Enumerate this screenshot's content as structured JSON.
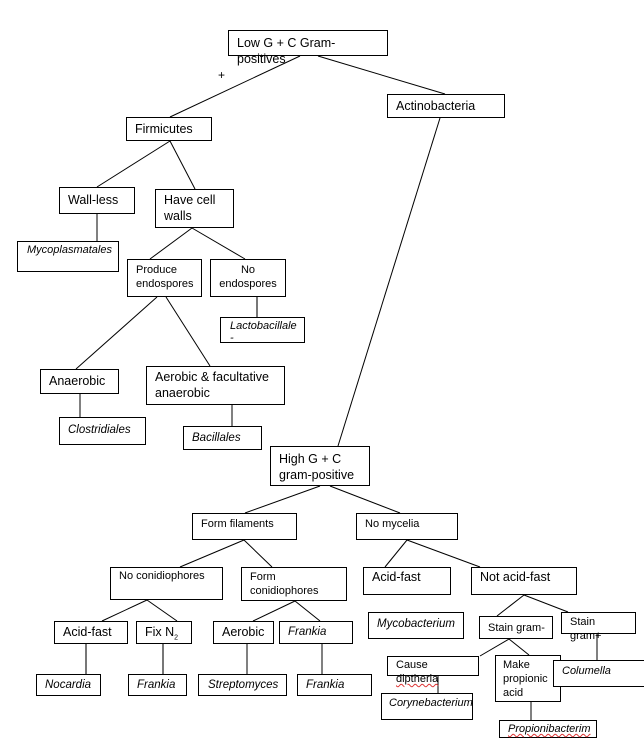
{
  "edge_label_plus": "+",
  "nodes": {
    "root": "Low G + C Gram-positives",
    "actinobacteria": "Actinobacteria",
    "firmicutes": "Firmicutes",
    "wall_less": "Wall-less",
    "have_cell_walls": "Have cell\nwalls",
    "mycoplasmatales": "Mycoplasmatales",
    "produce_endospores": "Produce\nendospores",
    "no_endospores": "No\nendospores",
    "lactobacillales": "Lactobacillale\n-",
    "anaerobic": "Anaerobic",
    "aerobic_facultative": "Aerobic & facultative\nanaerobic",
    "clostridiales": "Clostridiales",
    "bacillales": "Bacillales",
    "high_gc": "High G + C\ngram-positive",
    "form_filaments": "Form filaments",
    "no_mycelia": "No mycelia",
    "no_conidiophores": "No conidiophores",
    "form_conidiophores": "Form\nconidiophores",
    "acid_fast_right": "Acid-fast",
    "not_acid_fast": "Not acid-fast",
    "acid_fast_left": "Acid-fast",
    "fix_n2": "Fix N",
    "fix_n2_sub": "2",
    "aerobic": "Aerobic",
    "frankia_mid": "Frankia",
    "mycobacterium": "Mycobacterium",
    "stain_gram_neg": "Stain gram-",
    "stain_gram_pos": "Stain gram+",
    "nocardia": "Nocardia",
    "frankia_1": "Frankia",
    "streptomyces": "Streptomyces",
    "frankia_2": "Frankia",
    "cause_diptheria_prefix": "Cause ",
    "cause_diptheria_word": "diptheria",
    "make_propionic": "Make\npropionic\nacid",
    "columella": "Columella",
    "corynebacterium": "Corynebacterium",
    "propionibacterim": "Propionibacterim"
  },
  "colors": {
    "line": "#000000",
    "spellcheck": "#dd3333"
  }
}
